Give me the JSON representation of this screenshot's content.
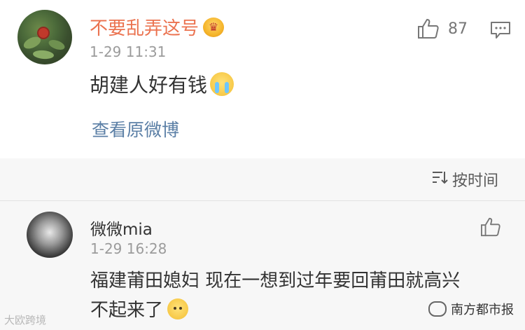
{
  "comment_main": {
    "username": "不要乱弄这号",
    "timestamp": "1-29 11:31",
    "text": "胡建人好有钱",
    "likes": "87",
    "view_original": "查看原微博"
  },
  "sort": {
    "label": "按时间"
  },
  "reply": {
    "username": "微微mia",
    "timestamp": "1-29 16:28",
    "text_line1": "福建莆田媳妇 现在一想到过年要回莆田就高兴",
    "text_line2": "不起来了"
  },
  "watermarks": {
    "left": "大欧跨境",
    "right": "南方都市报"
  },
  "colors": {
    "username_accent": "#eb7350",
    "link": "#5b7fa6",
    "text": "#333333",
    "meta": "#9b9b9b"
  },
  "icons": {
    "like": "thumbs-up-icon",
    "comment": "comment-bubble-icon",
    "sort": "sort-icon",
    "vip": "crown-badge-icon"
  }
}
